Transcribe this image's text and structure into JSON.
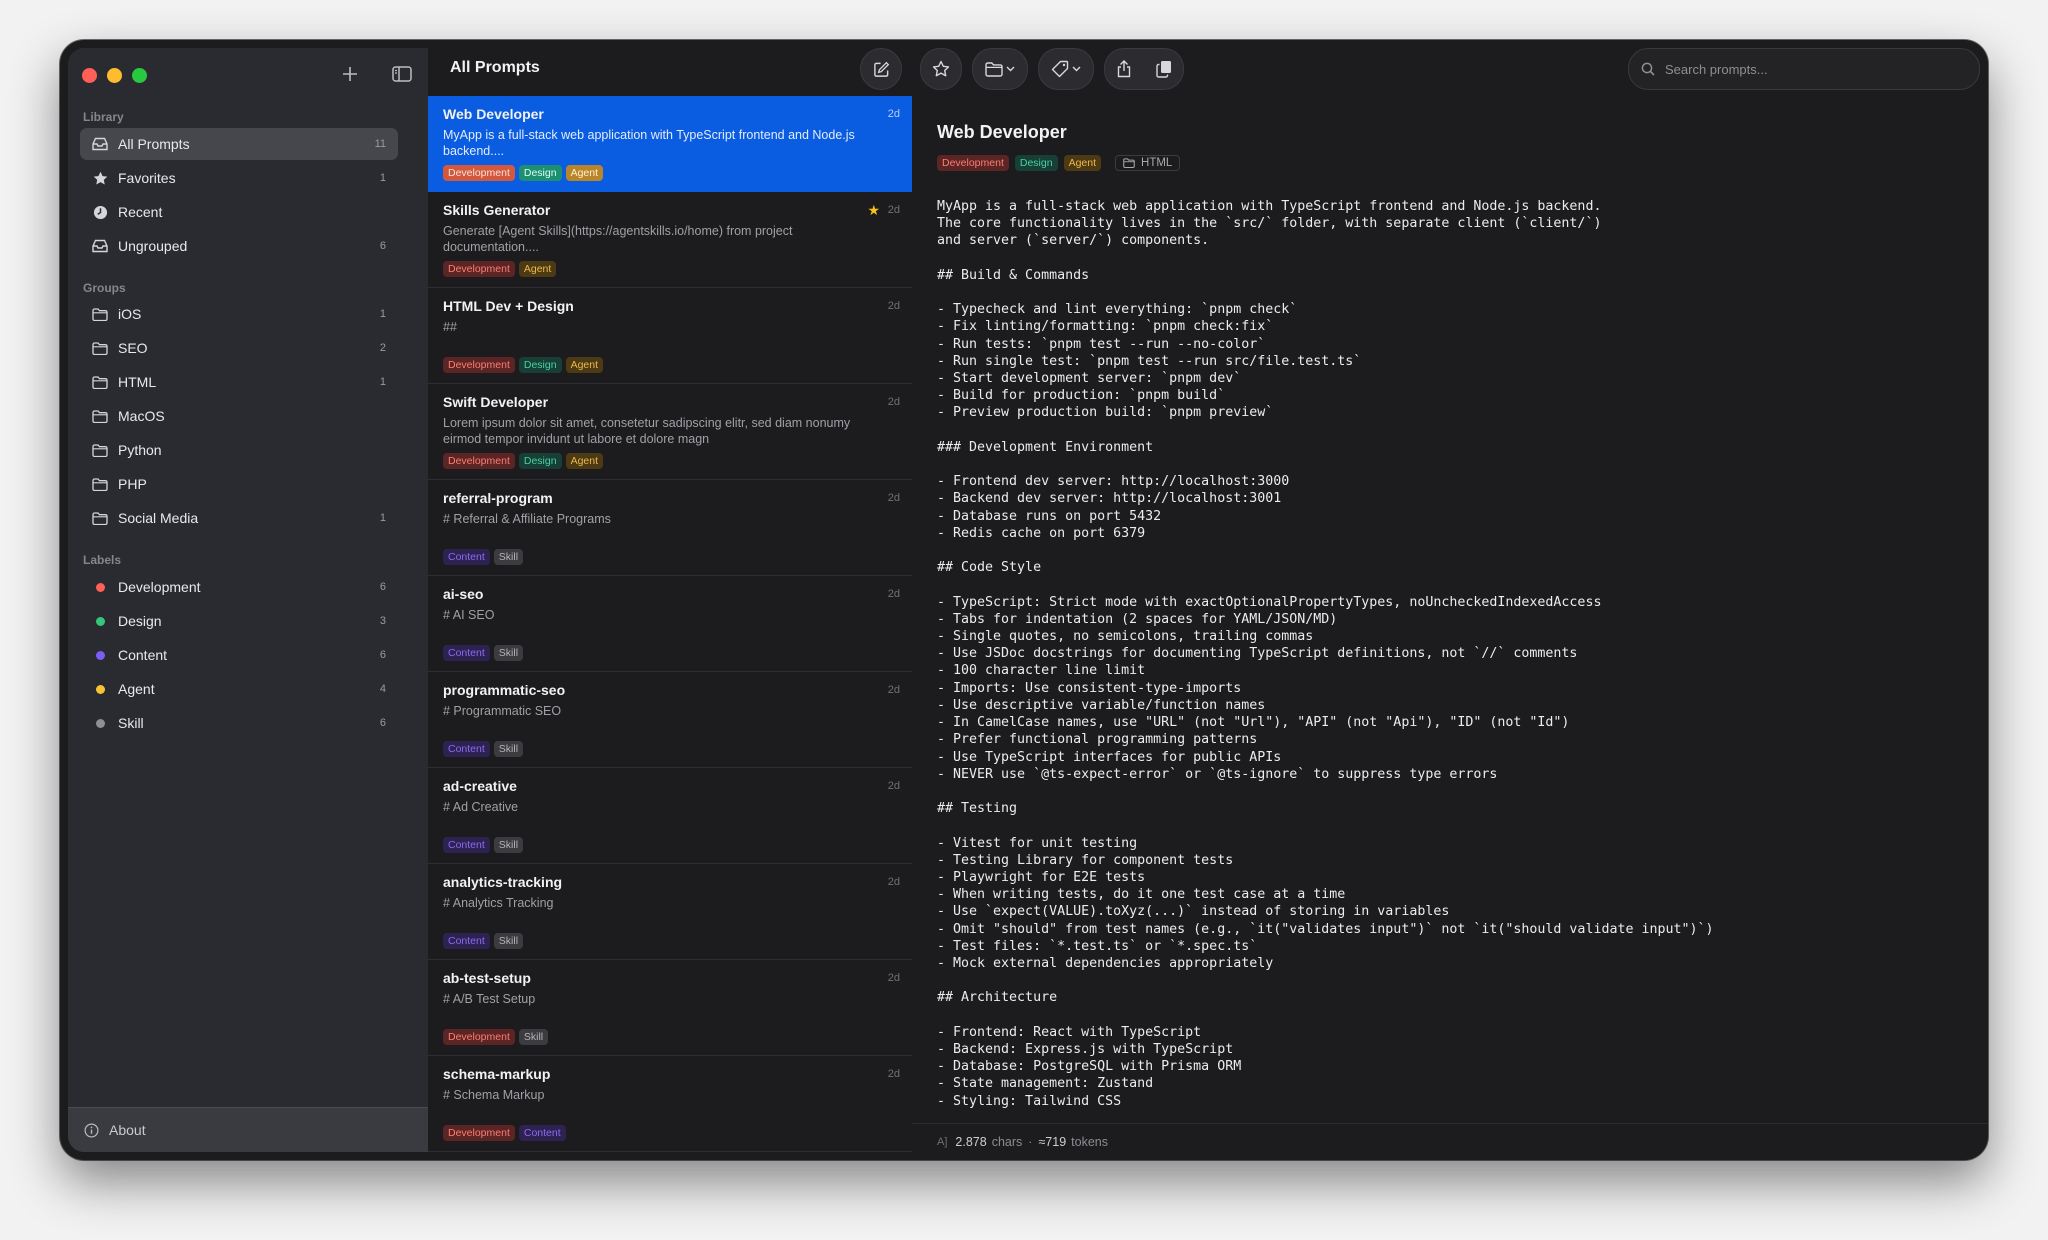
{
  "sidebar": {
    "library_label": "Library",
    "library": [
      {
        "label": "All Prompts",
        "count": "11",
        "icon": "tray-icon",
        "active": true
      },
      {
        "label": "Favorites",
        "count": "1",
        "icon": "star-icon"
      },
      {
        "label": "Recent",
        "count": "",
        "icon": "clock-icon"
      },
      {
        "label": "Ungrouped",
        "count": "6",
        "icon": "inbox-icon"
      }
    ],
    "groups_label": "Groups",
    "groups": [
      {
        "label": "iOS",
        "count": "1"
      },
      {
        "label": "SEO",
        "count": "2"
      },
      {
        "label": "HTML",
        "count": "1"
      },
      {
        "label": "MacOS",
        "count": ""
      },
      {
        "label": "Python",
        "count": ""
      },
      {
        "label": "PHP",
        "count": ""
      },
      {
        "label": "Social Media",
        "count": "1"
      }
    ],
    "labels_label": "Labels",
    "labels": [
      {
        "label": "Development",
        "count": "6",
        "color": "#ff5f57"
      },
      {
        "label": "Design",
        "count": "3",
        "color": "#34c77b"
      },
      {
        "label": "Content",
        "count": "6",
        "color": "#7b5cf5"
      },
      {
        "label": "Agent",
        "count": "4",
        "color": "#f7c236"
      },
      {
        "label": "Skill",
        "count": "6",
        "color": "#8e8e93"
      }
    ],
    "about": "About"
  },
  "list": {
    "title": "All Prompts",
    "items": [
      {
        "title": "Web Developer",
        "age": "2d",
        "desc": "MyApp is a full-stack web application with TypeScript frontend and Node.js backend....",
        "tags": [
          "Development",
          "Design",
          "Agent"
        ],
        "selected": true,
        "favorite": false
      },
      {
        "title": "Skills Generator",
        "age": "2d",
        "desc": "Generate [Agent Skills](https://agentskills.io/home) from project documentation....",
        "tags": [
          "Development",
          "Agent"
        ],
        "favorite": true
      },
      {
        "title": "HTML Dev + Design",
        "age": "2d",
        "desc": "##",
        "tags": [
          "Development",
          "Design",
          "Agent"
        ]
      },
      {
        "title": "Swift Developer",
        "age": "2d",
        "desc": "Lorem ipsum dolor sit amet, consetetur sadipscing elitr, sed diam nonumy eirmod tempor invidunt ut labore et dolore magn",
        "tags": [
          "Development",
          "Design",
          "Agent"
        ]
      },
      {
        "title": "referral-program",
        "age": "2d",
        "desc": "# Referral & Affiliate Programs",
        "tags": [
          "Content",
          "Skill"
        ]
      },
      {
        "title": "ai-seo",
        "age": "2d",
        "desc": "# AI SEO",
        "tags": [
          "Content",
          "Skill"
        ]
      },
      {
        "title": "programmatic-seo",
        "age": "2d",
        "desc": "# Programmatic SEO",
        "tags": [
          "Content",
          "Skill"
        ]
      },
      {
        "title": "ad-creative",
        "age": "2d",
        "desc": "# Ad Creative",
        "tags": [
          "Content",
          "Skill"
        ]
      },
      {
        "title": "analytics-tracking",
        "age": "2d",
        "desc": "# Analytics Tracking",
        "tags": [
          "Content",
          "Skill"
        ]
      },
      {
        "title": "ab-test-setup",
        "age": "2d",
        "desc": "# A/B Test Setup",
        "tags": [
          "Development",
          "Skill"
        ]
      },
      {
        "title": "schema-markup",
        "age": "2d",
        "desc": "# Schema Markup",
        "tags": [
          "Development",
          "Content"
        ]
      }
    ]
  },
  "search": {
    "placeholder": "Search prompts..."
  },
  "detail": {
    "title": "Web Developer",
    "tags": [
      "Development",
      "Design",
      "Agent"
    ],
    "group": "HTML",
    "content": "MyApp is a full-stack web application with TypeScript frontend and Node.js backend.\nThe core functionality lives in the `src/` folder, with separate client (`client/`)\nand server (`server/`) components.\n\n## Build & Commands\n\n- Typecheck and lint everything: `pnpm check`\n- Fix linting/formatting: `pnpm check:fix`\n- Run tests: `pnpm test --run --no-color`\n- Run single test: `pnpm test --run src/file.test.ts`\n- Start development server: `pnpm dev`\n- Build for production: `pnpm build`\n- Preview production build: `pnpm preview`\n\n### Development Environment\n\n- Frontend dev server: http://localhost:3000\n- Backend dev server: http://localhost:3001\n- Database runs on port 5432\n- Redis cache on port 6379\n\n## Code Style\n\n- TypeScript: Strict mode with exactOptionalPropertyTypes, noUncheckedIndexedAccess\n- Tabs for indentation (2 spaces for YAML/JSON/MD)\n- Single quotes, no semicolons, trailing commas\n- Use JSDoc docstrings for documenting TypeScript definitions, not `//` comments\n- 100 character line limit\n- Imports: Use consistent-type-imports\n- Use descriptive variable/function names\n- In CamelCase names, use \"URL\" (not \"Url\"), \"API\" (not \"Api\"), \"ID\" (not \"Id\")\n- Prefer functional programming patterns\n- Use TypeScript interfaces for public APIs\n- NEVER use `@ts-expect-error` or `@ts-ignore` to suppress type errors\n\n## Testing\n\n- Vitest for unit testing\n- Testing Library for component tests\n- Playwright for E2E tests\n- When writing tests, do it one test case at a time\n- Use `expect(VALUE).toXyz(...)` instead of storing in variables\n- Omit \"should\" from test names (e.g., `it(\"validates input\")` not `it(\"should validate input\")`)\n- Test files: `*.test.ts` or `*.spec.ts`\n- Mock external dependencies appropriately\n\n## Architecture\n\n- Frontend: React with TypeScript\n- Backend: Express.js with TypeScript\n- Database: PostgreSQL with Prisma ORM\n- State management: Zustand\n- Styling: Tailwind CSS",
    "stats": {
      "icon_text": "A]",
      "chars": "2.878",
      "chars_label": "chars",
      "separator": "·",
      "tokens": "≈719",
      "tokens_label": "tokens"
    }
  }
}
